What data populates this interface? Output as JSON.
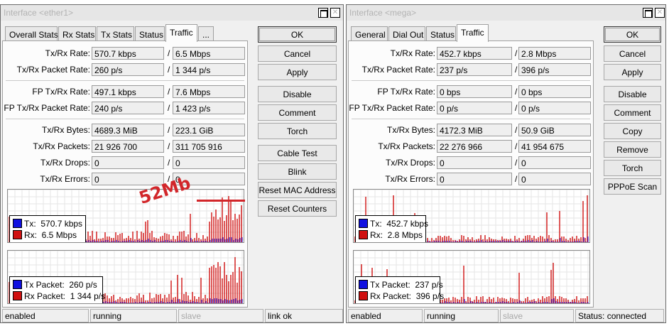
{
  "left": {
    "title": "Interface <ether1>",
    "tabs": [
      "Overall Stats",
      "Rx Stats",
      "Tx Stats",
      "Status",
      "Traffic",
      "..."
    ],
    "active_tab": "Traffic",
    "rows": [
      {
        "label": "Tx/Rx Rate:",
        "a": "570.7 kbps",
        "b": "6.5 Mbps"
      },
      {
        "label": "Tx/Rx Packet Rate:",
        "a": "260 p/s",
        "b": "1 344 p/s"
      },
      {
        "label": "FP Tx/Rx Rate:",
        "a": "497.1 kbps",
        "b": "7.6 Mbps"
      },
      {
        "label": "FP Tx/Rx Packet Rate:",
        "a": "240 p/s",
        "b": "1 423 p/s"
      },
      {
        "label": "Tx/Rx Bytes:",
        "a": "4689.3 MiB",
        "b": "223.1 GiB"
      },
      {
        "label": "Tx/Rx Packets:",
        "a": "21 926 700",
        "b": "311 705 916"
      },
      {
        "label": "Tx/Rx Drops:",
        "a": "0",
        "b": "0"
      },
      {
        "label": "Tx/Rx Errors:",
        "a": "0",
        "b": "0"
      }
    ],
    "graph1": {
      "tx_label": "Tx:",
      "tx_value": "570.7 kbps",
      "rx_label": "Rx:",
      "rx_value": "6.5 Mbps"
    },
    "graph2": {
      "tx_label": "Tx Packet:",
      "tx_value": "260 p/s",
      "rx_label": "Rx Packet:",
      "rx_value": "1 344 p/s"
    },
    "buttons": [
      "OK",
      "Cancel",
      "Apply",
      "Disable",
      "Comment",
      "Torch",
      "Cable Test",
      "Blink",
      "Reset MAC Address",
      "Reset Counters"
    ],
    "status": [
      "enabled",
      "running",
      "slave",
      "link ok"
    ],
    "annotation": "52Mb"
  },
  "right": {
    "title": "Interface <mega>",
    "tabs": [
      "General",
      "Dial Out",
      "Status",
      "Traffic"
    ],
    "active_tab": "Traffic",
    "rows": [
      {
        "label": "Tx/Rx Rate:",
        "a": "452.7 kbps",
        "b": "2.8 Mbps"
      },
      {
        "label": "Tx/Rx Packet Rate:",
        "a": "237 p/s",
        "b": "396 p/s"
      },
      {
        "label": "FP Tx/Rx Rate:",
        "a": "0 bps",
        "b": "0 bps"
      },
      {
        "label": "FP Tx/Rx Packet Rate:",
        "a": "0 p/s",
        "b": "0 p/s"
      },
      {
        "label": "Tx/Rx Bytes:",
        "a": "4172.3 MiB",
        "b": "50.9 GiB"
      },
      {
        "label": "Tx/Rx Packets:",
        "a": "22 276 966",
        "b": "41 954 675"
      },
      {
        "label": "Tx/Rx Drops:",
        "a": "0",
        "b": "0"
      },
      {
        "label": "Tx/Rx Errors:",
        "a": "0",
        "b": "0"
      }
    ],
    "graph1": {
      "tx_label": "Tx:",
      "tx_value": "452.7 kbps",
      "rx_label": "Rx:",
      "rx_value": "2.8 Mbps"
    },
    "graph2": {
      "tx_label": "Tx Packet:",
      "tx_value": "237 p/s",
      "rx_label": "Rx Packet:",
      "rx_value": "396 p/s"
    },
    "buttons": [
      "OK",
      "Cancel",
      "Apply",
      "Disable",
      "Comment",
      "Copy",
      "Remove",
      "Torch",
      "PPPoE Scan"
    ],
    "status": [
      "enabled",
      "running",
      "slave",
      "Status: connected"
    ]
  },
  "colors": {
    "tx": "#1010e0",
    "rx": "#d01010",
    "annotation": "#d2262a"
  },
  "icons": {
    "close": "close-icon",
    "maximize": "maximize-icon"
  }
}
